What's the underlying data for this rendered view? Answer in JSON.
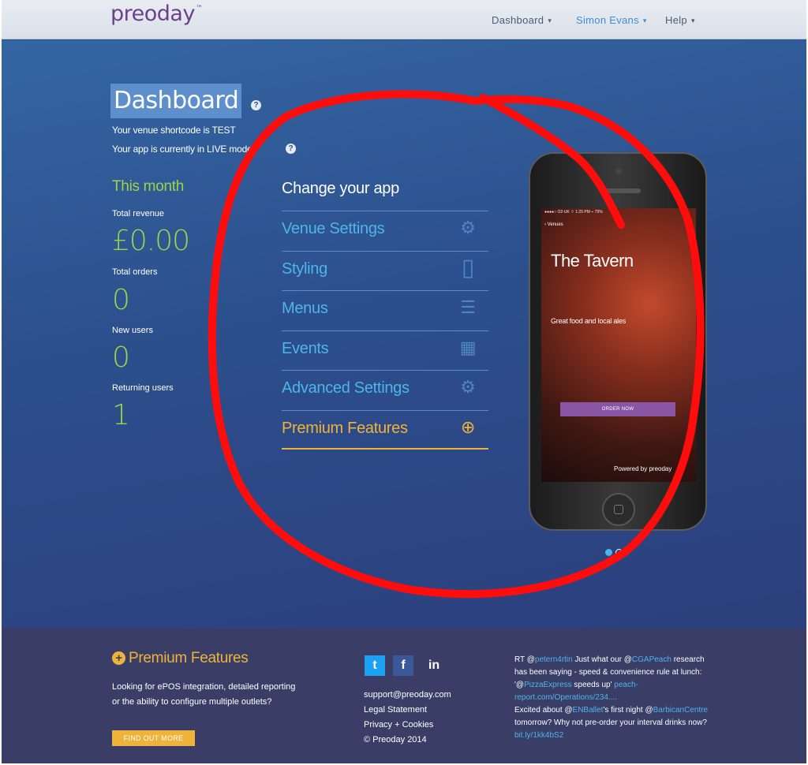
{
  "header": {
    "logo": "preoday",
    "logo_tm": "™",
    "nav": [
      {
        "label": "Dashboard",
        "caret": "▾"
      },
      {
        "label": "Simon Evans",
        "caret": "▾"
      },
      {
        "label": "Help",
        "caret": "▾"
      }
    ]
  },
  "dashboard": {
    "title": "Dashboard",
    "shortcode_text": "Your venue shortcode is TEST",
    "mode_text": "Your app is currently in LIVE mode.",
    "help_glyph": "?"
  },
  "stats": {
    "heading": "This month",
    "total_revenue_label": "Total revenue",
    "total_revenue": "£0.00",
    "total_orders_label": "Total orders",
    "total_orders": "0",
    "new_users_label": "New users",
    "new_users": "0",
    "returning_users_label": "Returning users",
    "returning_users": "1"
  },
  "change_app": {
    "heading": "Change your app",
    "items": [
      {
        "label": "Venue Settings",
        "icon": "gear-icon",
        "glyph": "⚙"
      },
      {
        "label": "Styling",
        "icon": "phone-icon",
        "glyph": "▯"
      },
      {
        "label": "Menus",
        "icon": "menu-list-icon",
        "glyph": "☰"
      },
      {
        "label": "Events",
        "icon": "calendar-icon",
        "glyph": "▦"
      },
      {
        "label": "Advanced Settings",
        "icon": "gear-icon",
        "glyph": "⚙"
      },
      {
        "label": "Premium Features",
        "icon": "plus-circle-icon",
        "glyph": "⊕"
      }
    ]
  },
  "phone_preview": {
    "status_bar": "●●●●○ O2-UK  ⌔        1:25 PM        ⌁ 75%",
    "back_label": "‹ Venues",
    "venue_name": "The Tavern",
    "tagline": "Great food and local ales",
    "order_button": "ORDER NOW",
    "powered_by": "Powered by preoday"
  },
  "carousel": {
    "active_index": 0,
    "count": 2,
    "active_color": "#4fb4ea",
    "inactive_color": "#ffffff"
  },
  "footer": {
    "premium_title": "Premium Features",
    "premium_text": "Looking for ePOS integration, detailed reporting or the ability to configure multiple outlets?",
    "find_out_more": "FIND OUT MORE",
    "social": [
      {
        "name": "twitter-icon",
        "glyph": "t",
        "color": "#1da1f2"
      },
      {
        "name": "facebook-icon",
        "glyph": "f",
        "color": "#3b5998"
      },
      {
        "name": "linkedin-icon",
        "glyph": "in",
        "color": "transparent"
      }
    ],
    "links": [
      "support@preoday.com",
      "Legal Statement",
      "Privacy + Cookies",
      "© Preoday 2014"
    ],
    "tweets": [
      [
        {
          "t": "RT @",
          "a": false
        },
        {
          "t": "petern4rtin",
          "a": true
        },
        {
          "t": " Just what our @",
          "a": false
        },
        {
          "t": "CGAPeach",
          "a": true
        },
        {
          "t": " research has been saying - speed & convenience rule at lunch: '@",
          "a": false
        },
        {
          "t": "PizzaExpress",
          "a": true
        },
        {
          "t": " speeds up' ",
          "a": false
        },
        {
          "t": "peach-report.com/Operations/234....",
          "a": true
        }
      ],
      [
        {
          "t": "Excited about @",
          "a": false
        },
        {
          "t": "ENBallet",
          "a": true
        },
        {
          "t": "'s first night @",
          "a": false
        },
        {
          "t": "BarbicanCentre",
          "a": true
        },
        {
          "t": " tomorrow? Why not pre-order your interval drinks now? ",
          "a": false
        },
        {
          "t": "bit.ly/1kk4bS2",
          "a": true
        }
      ]
    ]
  },
  "colors": {
    "accent_green": "#9ed24b",
    "accent_blue": "#4fb4ea",
    "accent_orange": "#f0b33a",
    "annotation_red": "#ff0d0d"
  }
}
